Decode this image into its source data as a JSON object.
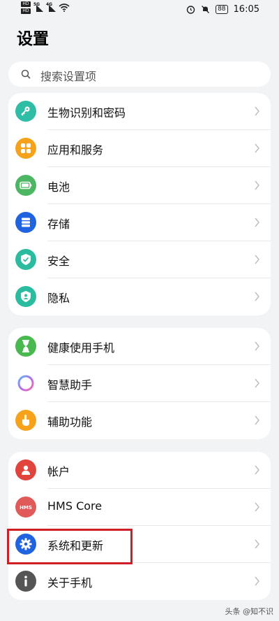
{
  "status": {
    "hd1": "HD",
    "hd2": "HD",
    "sig1": "5G",
    "sig2": "4G",
    "battery": "88",
    "time": "16:05"
  },
  "page_title": "设置",
  "search": {
    "placeholder": "搜索设置项"
  },
  "groups": [
    {
      "items": [
        {
          "label": "生物识别和密码",
          "icon": "key-icon",
          "color": "#2fbda6"
        },
        {
          "label": "应用和服务",
          "icon": "apps-grid-icon",
          "color": "#f7a21b"
        },
        {
          "label": "电池",
          "icon": "battery-icon",
          "color": "#4cb663"
        },
        {
          "label": "存储",
          "icon": "storage-icon",
          "color": "#1f63e0"
        },
        {
          "label": "安全",
          "icon": "shield-check-icon",
          "color": "#2bbca0"
        },
        {
          "label": "隐私",
          "icon": "privacy-shield-icon",
          "color": "#2bbca0"
        }
      ]
    },
    {
      "items": [
        {
          "label": "健康使用手机",
          "icon": "hourglass-icon",
          "color": "#49b94f"
        },
        {
          "label": "智慧助手",
          "icon": "assistant-ring-icon",
          "color": "#a974e8"
        },
        {
          "label": "辅助功能",
          "icon": "hand-icon",
          "color": "#f7a21b"
        }
      ]
    },
    {
      "items": [
        {
          "label": "帐户",
          "icon": "person-icon",
          "color": "#e0443c"
        },
        {
          "label": "HMS Core",
          "icon": "hms-icon",
          "color": "#e15a5a"
        },
        {
          "label": "系统和更新",
          "icon": "gear-icon",
          "color": "#1f63e0"
        },
        {
          "label": "关于手机",
          "icon": "info-icon",
          "color": "#555555"
        }
      ]
    }
  ],
  "watermark": "头条 @知不识"
}
